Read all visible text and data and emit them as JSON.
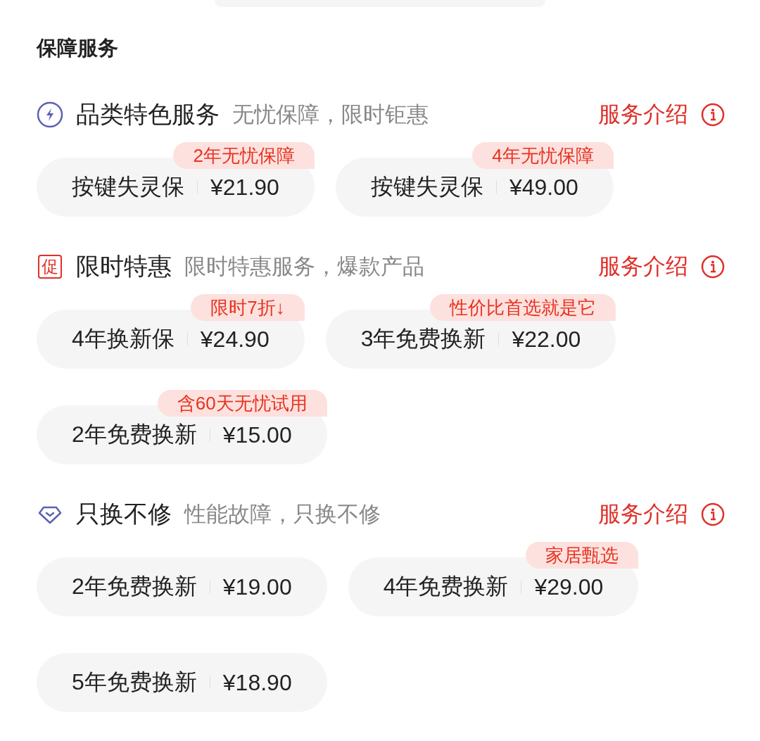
{
  "section_title": "保障服务",
  "groups": [
    {
      "kind": "bolt",
      "title": "品类特色服务",
      "subtitle": "无忧保障，限时钜惠",
      "link": "服务介绍",
      "options": [
        {
          "name": "按键失灵保",
          "price": "¥21.90",
          "badge": "2年无忧保障"
        },
        {
          "name": "按键失灵保",
          "price": "¥49.00",
          "badge": "4年无忧保障"
        }
      ]
    },
    {
      "kind": "stamp",
      "icon_text": "促",
      "title": "限时特惠",
      "subtitle": "限时特惠服务，爆款产品",
      "link": "服务介绍",
      "options": [
        {
          "name": "4年换新保",
          "price": "¥24.90",
          "badge": "限时7折↓"
        },
        {
          "name": "3年免费换新",
          "price": "¥22.00",
          "badge": "性价比首选就是它"
        },
        {
          "name": "2年免费换新",
          "price": "¥15.00",
          "badge": "含60天无忧试用"
        }
      ]
    },
    {
      "kind": "gem",
      "title": "只换不修",
      "subtitle": "性能故障，只换不修",
      "link": "服务介绍",
      "options": [
        {
          "name": "2年免费换新",
          "price": "¥19.00"
        },
        {
          "name": "4年免费换新",
          "price": "¥29.00",
          "badge": "家居甄选"
        },
        {
          "name": "5年免费换新",
          "price": "¥18.90"
        }
      ]
    }
  ]
}
